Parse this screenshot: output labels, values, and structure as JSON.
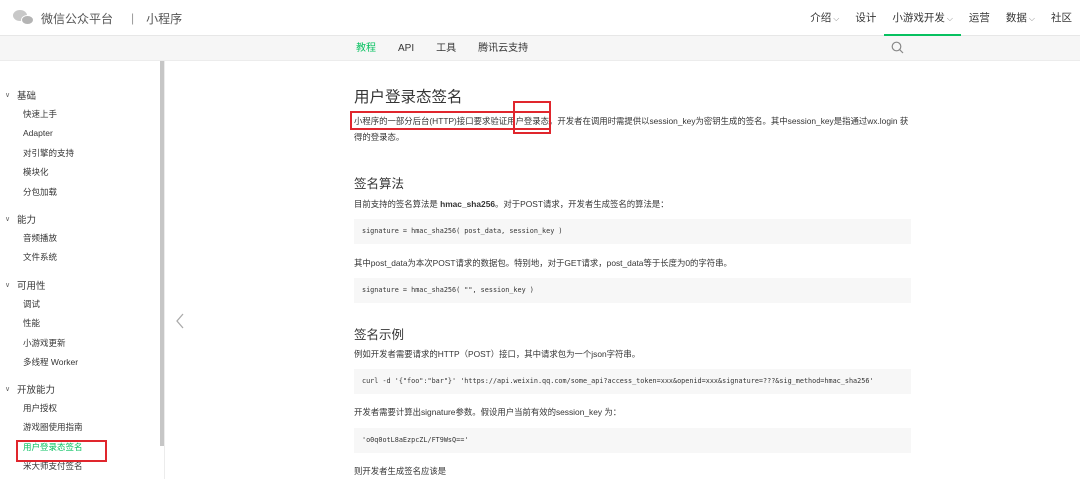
{
  "header": {
    "brand_name": "微信公众平台",
    "separator": "|",
    "brand_sub": "小程序",
    "nav": [
      {
        "label": "介绍",
        "has_dropdown": true
      },
      {
        "label": "设计",
        "has_dropdown": false
      },
      {
        "label": "小游戏开发",
        "has_dropdown": true,
        "active": true
      },
      {
        "label": "运营",
        "has_dropdown": false
      },
      {
        "label": "数据",
        "has_dropdown": true
      },
      {
        "label": "社区",
        "has_dropdown": false
      }
    ],
    "accent_color": "#07c160"
  },
  "subnav": {
    "tabs": [
      "教程",
      "API",
      "工具",
      "腾讯云支持"
    ],
    "active_tab": "教程",
    "search_icon": "search-icon"
  },
  "sidebar": {
    "groups": [
      {
        "title": "基础",
        "items": [
          "快速上手",
          "Adapter",
          "对引擎的支持",
          "模块化",
          "分包加载"
        ]
      },
      {
        "title": "能力",
        "items": [
          "音频播放",
          "文件系统"
        ]
      },
      {
        "title": "可用性",
        "items": [
          "调试",
          "性能",
          "小游戏更新",
          "多线程 Worker"
        ]
      },
      {
        "title": "开放能力",
        "items": [
          "用户授权",
          "游戏圈使用指南",
          "用户登录态签名",
          "米大师支付签名"
        ]
      }
    ],
    "active_item": "用户登录态签名"
  },
  "main": {
    "title": "用户登录态签名",
    "intro_1": "小程序的一部分后台(HTTP)接口要求验证用户登录态。开发者在调用时需提供以session_key为密钥生成的签名。其中session_key是指通过wx.login 获",
    "intro_2": "得的登录态。",
    "section1_title": "签名算法",
    "s1_text_pre": "目前支持的签名算法是 ",
    "s1_text_bold": "hmac_sha256",
    "s1_text_post": "。对于POST请求，开发者生成签名的算法是：",
    "code1": "signature = hmac_sha256( post_data, session_key )",
    "s1_text2": "其中post_data为本次POST请求的数据包。特别地，对于GET请求，post_data等于长度为0的字符串。",
    "code2": "signature = hmac_sha256( \"\", session_key )",
    "section2_title": "签名示例",
    "s2_text1": "例如开发者需要请求的HTTP（POST）接口，其中请求包为一个json字符串。",
    "code3": "curl -d '{\"foo\":\"bar\"}' 'https://api.weixin.qq.com/some_api?access_token=xxx&openid=xxx&signature=???&sig_method=hmac_sha256'",
    "s2_text2": "开发者需要计算出signature参数。假设用户当前有效的session_key 为：",
    "code4": "'o0q0otL8aEzpcZL/FT9WsQ=='",
    "s2_text3": "则开发者生成签名应该是"
  }
}
